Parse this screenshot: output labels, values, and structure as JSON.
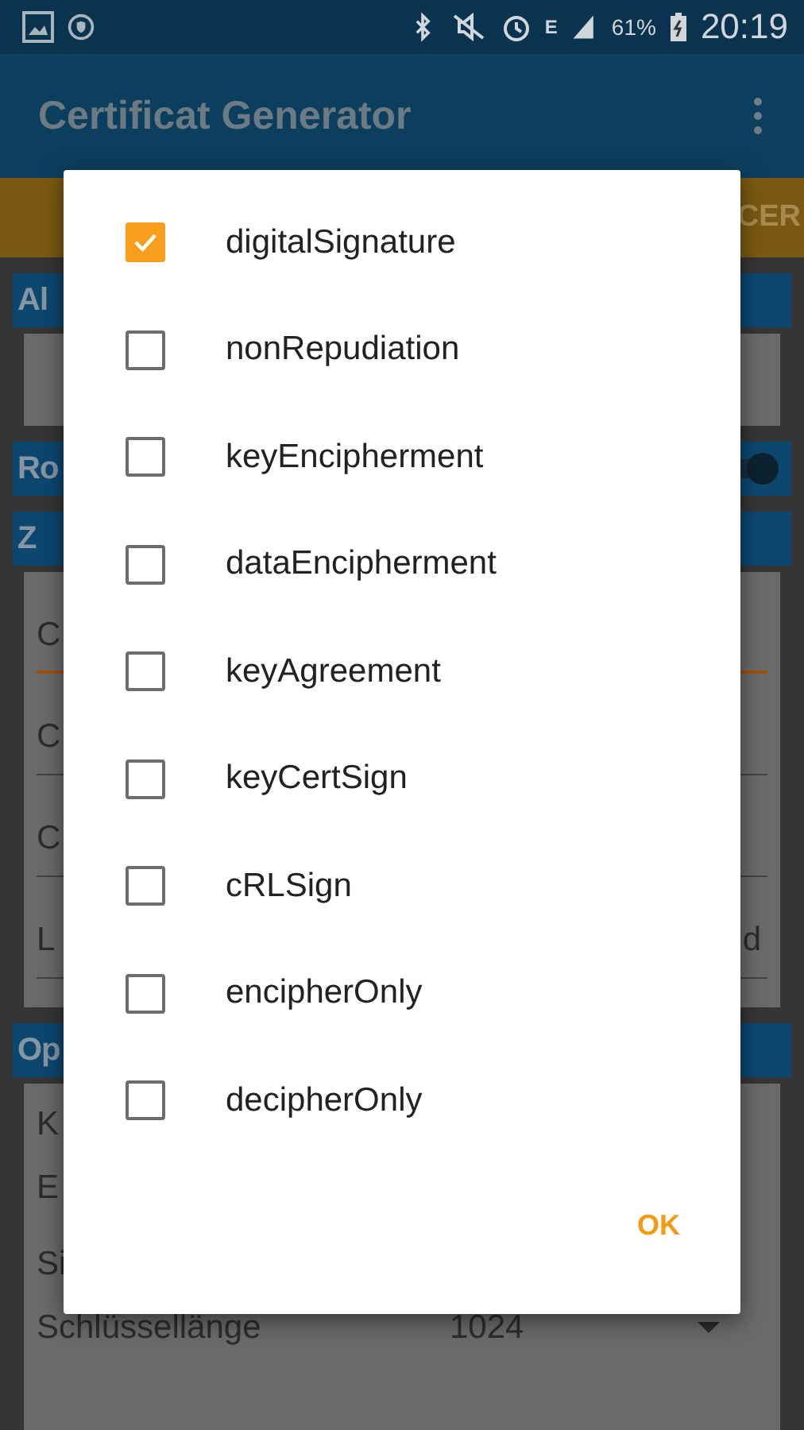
{
  "status_bar": {
    "network": "E",
    "battery": "61%",
    "time": "20:19"
  },
  "app_bar": {
    "title": "Certificat Generator"
  },
  "action_bar": {
    "button": "CER"
  },
  "sections": [
    {
      "header": "Al",
      "kind": "card"
    },
    {
      "header": "Ro",
      "kind": "switch",
      "on": true
    },
    {
      "header": "Z",
      "kind": "fields",
      "rows": [
        {
          "label": "C",
          "focused": true
        },
        {
          "label": "C",
          "focused": false
        },
        {
          "label": "C",
          "focused": false
        },
        {
          "label": "L",
          "value": "d",
          "focused": false
        }
      ]
    },
    {
      "header": "Op",
      "kind": "options",
      "rows": [
        {
          "label": "K"
        },
        {
          "label": "E"
        },
        {
          "label": "Si"
        },
        {
          "label": "Schlüssellänge",
          "value": "1024"
        }
      ]
    }
  ],
  "dialog": {
    "options": [
      {
        "label": "digitalSignature",
        "checked": true
      },
      {
        "label": "nonRepudiation",
        "checked": false
      },
      {
        "label": "keyEncipherment",
        "checked": false
      },
      {
        "label": "dataEncipherment",
        "checked": false
      },
      {
        "label": "keyAgreement",
        "checked": false
      },
      {
        "label": "keyCertSign",
        "checked": false
      },
      {
        "label": "cRLSign",
        "checked": false
      },
      {
        "label": "encipherOnly",
        "checked": false
      },
      {
        "label": "decipherOnly",
        "checked": false
      }
    ],
    "ok_button": "OK"
  }
}
